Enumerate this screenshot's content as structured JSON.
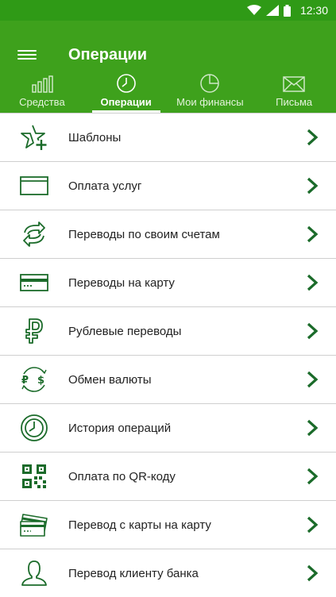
{
  "status": {
    "time": "12:30"
  },
  "header": {
    "title": "Операции"
  },
  "tabs": [
    {
      "label": "Средства",
      "icon": "bar-chart-icon",
      "active": false
    },
    {
      "label": "Операции",
      "icon": "clock-icon",
      "active": true
    },
    {
      "label": "Мои финансы",
      "icon": "pie-chart-icon",
      "active": false
    },
    {
      "label": "Письма",
      "icon": "envelope-icon",
      "active": false
    }
  ],
  "menu": [
    {
      "label": "Шаблоны",
      "icon": "star-plus-icon"
    },
    {
      "label": "Оплата услуг",
      "icon": "window-icon"
    },
    {
      "label": "Переводы по своим счетам",
      "icon": "transfer-arrows-icon"
    },
    {
      "label": "Переводы на карту",
      "icon": "card-icon"
    },
    {
      "label": "Рублевые переводы",
      "icon": "ruble-icon"
    },
    {
      "label": "Обмен валюты",
      "icon": "currency-exchange-icon"
    },
    {
      "label": "История операций",
      "icon": "clock-icon"
    },
    {
      "label": "Оплата по QR-коду",
      "icon": "qr-code-icon"
    },
    {
      "label": "Перевод с карты на карту",
      "icon": "cards-icon"
    },
    {
      "label": "Перевод клиенту банка",
      "icon": "person-icon"
    }
  ],
  "colors": {
    "appbar": "#3ea11c",
    "statusbar": "#2f9a16",
    "icon_green": "#1b6b2a",
    "chevron_green": "#1b6b2a"
  }
}
